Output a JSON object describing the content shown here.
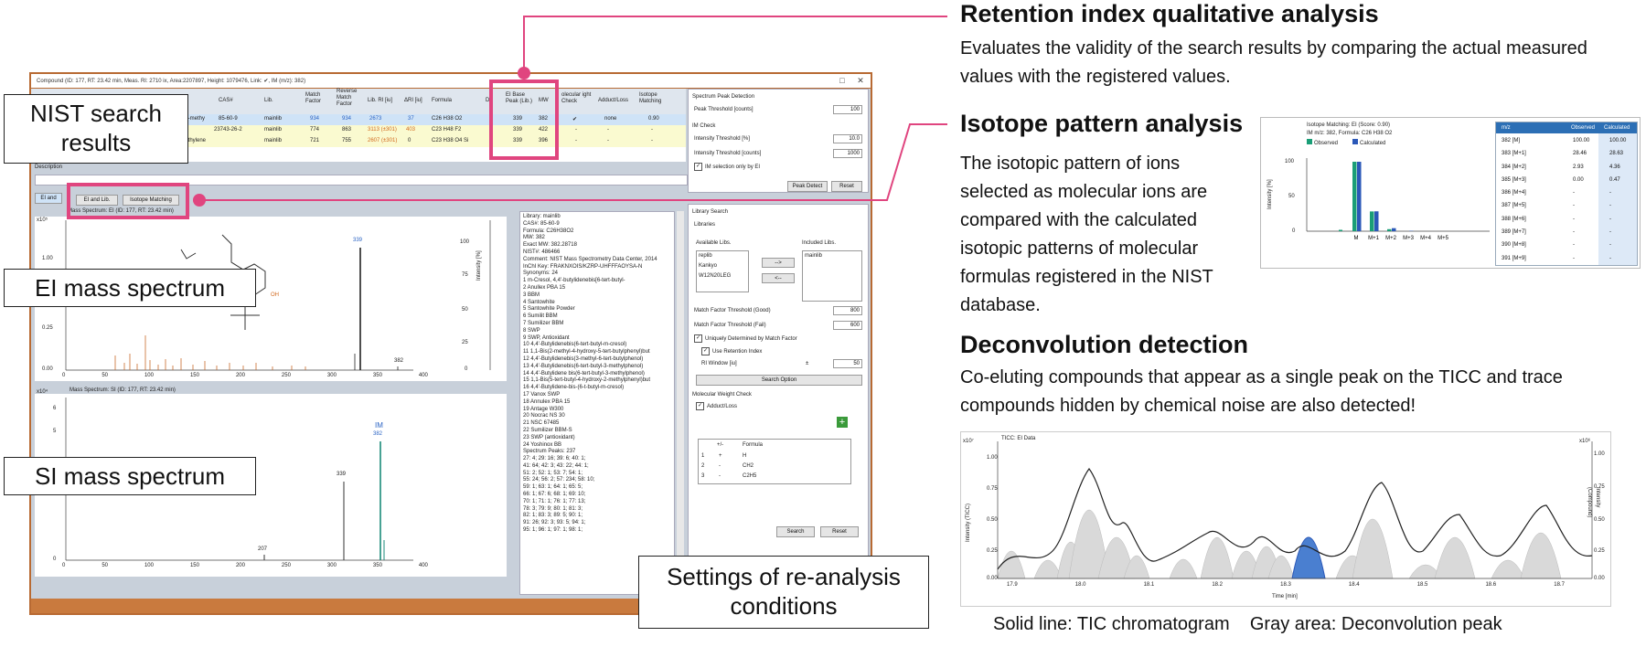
{
  "window": {
    "title": "Compound (ID: 177, RT: 23.42 min, Meas. RI: 2710 ix, Area:2207897, Height: 1079476, Link: ✔, IM (m/z): 382)",
    "controls": [
      "□",
      "✕"
    ]
  },
  "results_table": {
    "headers": [
      "CAS#",
      "Lib.",
      "Match Factor",
      "Reverse Match Factor",
      "Lib. RI [iu]",
      "ΔRI [iu]",
      "Formula",
      "D",
      "EI Base Peak (Lib.)",
      "MW",
      "olecular ight Check",
      "Adduct/Loss",
      "Isotope Matching"
    ],
    "rows": [
      {
        "name": "l-5-methy",
        "cas": "85-60-9",
        "lib": "mainlib",
        "mf": "934",
        "rmf": "934",
        "ri": "2673",
        "dri": "37",
        "formula": "C26 H38 O2",
        "base": "339",
        "mw": "382",
        "mwcheck": "✔",
        "adduct": "none",
        "iso": "0.90"
      },
      {
        "name": "",
        "cas": "23743-26-2",
        "lib": "mainlib",
        "mf": "774",
        "rmf": "863",
        "ri": "3113 (±301)",
        "dri": "403",
        "formula": "C23 H48 F2",
        "base": "339",
        "mw": "422",
        "mwcheck": "-",
        "adduct": "-",
        "iso": "-"
      },
      {
        "name": "nethylene",
        "cas": "",
        "lib": "mainlib",
        "mf": "721",
        "rmf": "755",
        "ri": "2607 (±301)",
        "dri": "0",
        "formula": "C23 H38 O4 Si",
        "base": "339",
        "mw": "396",
        "mwcheck": "-",
        "adduct": "-",
        "iso": "-"
      }
    ],
    "description_label": "Description"
  },
  "tabs": {
    "ei_and": "EI and",
    "ei_and_lib": "EI and Lib.",
    "isotope_matching": "Isotope Matching"
  },
  "ei_spectrum": {
    "title": "Mass Spectrum: EI (ID: 177, RT: 23.42 min)",
    "exp": "x10⁵",
    "yticks": [
      "1.00",
      "0.75",
      "0.50",
      "0.25",
      "0.00"
    ],
    "rticks": [
      "100",
      "75",
      "50",
      "25",
      "0"
    ],
    "xticks": [
      "0",
      "50",
      "100",
      "150",
      "200",
      "250",
      "300",
      "350",
      "400"
    ],
    "xlabel": "m/z",
    "ylabel_right": "Intensity [%]",
    "peak_labels": [
      "339",
      "382"
    ],
    "oh": "OH"
  },
  "si_spectrum": {
    "title": "Mass Spectrum: SI (ID: 177, RT: 23.42 min)",
    "exp": "x10⁴",
    "yticks": [
      "6",
      "5",
      "4",
      "3",
      "2",
      "1",
      "0"
    ],
    "xticks": [
      "0",
      "50",
      "100",
      "150",
      "200",
      "250",
      "300",
      "350",
      "400"
    ],
    "xlabel": "m/z",
    "peak_labels": [
      "339",
      "207",
      "IM",
      "382"
    ]
  },
  "library_info": {
    "lines": [
      "Library: mainlib",
      "CAS#: 85-60-9",
      "Formula: C26H38O2",
      "MW: 382",
      "Exact MW: 382.28718",
      "NIST#: 486466",
      "Comment: NIST Mass Spectrometry Data Center, 2014",
      "InChI Key: FRAKNXOIS/KZRP-UHFFFAOYSA-N",
      "Synonyms: 24",
      "1 m-Cresol, 4,4'-butylidenebis[6-tert-butyl-",
      "2 Anullex PBA 15",
      "3 BBM",
      "4 Santowhite",
      "5 Santowhite Powder",
      "6 Sumilit BBM",
      "7 Sumilizer BBM",
      "8 SWP",
      "9 SWP, Antioxidant",
      "10 4,4'-Butylidenebis(6-tert-butyl-m-cresol)",
      "11 1,1-Bis(2-methyl-4-hydroxy-5-tert-butylphenyl)but",
      "12 4,4'-Butylidenebis(3-methyl-6-tert-butylphenol)",
      "13 4,4'-Butylidenebis(6-tert-butyl-3-methylphenol)",
      "14 4,4'-Butylidene bis(6-tert-butyl-3-methylphenol)",
      "15 1,1-Bis(5-tert-butyl-4-hydroxy-2-methylphenyl)but",
      "16 4,4'-Butylidene-bis-(6-t-butyl-m-cresol)",
      "17 Vanox SWP",
      "18 Annulex PBA 15",
      "19 Antage W300",
      "20 Nocrac NS 30",
      "21 NSC 67485",
      "22 Sumilizer BBM-S",
      "23 SWP (antioxidant)",
      "24 Yoshinox BB",
      "Spectrum Peaks: 237",
      "27: 4;  29: 16;  39: 6;  40: 1;",
      "41: 64;  42: 3;  43: 22;  44: 1;",
      "51: 2;  52: 1;  53: 7;  54: 1;",
      "55: 24;  56: 2;  57: 234;  58: 10;",
      "59: 1;  63: 1;  64: 1;  65: 5;",
      "66: 1;  67: 6;  68: 1;  69: 10;",
      "70: 1;  71: 1;  76: 1;  77: 13;",
      "78: 3;  79: 9;  80: 1;  81: 3;",
      "82: 1;  83: 3;  89: 5;  90: 1;",
      "91: 26;  92: 3;  93: 5;  94: 1;",
      "95: 1;  96: 1;  97: 1;  98: 1;"
    ]
  },
  "peak_detection": {
    "title": "Spectrum Peak Detection",
    "peak_threshold_label": "Peak Threshold [counts]",
    "peak_threshold": "100",
    "im_check": "IM Check",
    "intensity_pct_label": "Intensity Threshold [%]",
    "intensity_pct": "10.0",
    "intensity_counts_label": "Intensity Threshold [counts]",
    "intensity_counts": "1000",
    "im_selection": "IM selection only by EI",
    "peak_detect_btn": "Peak Detect",
    "reset_btn": "Reset"
  },
  "library_search": {
    "title": "Library Search",
    "libraries": "Libraries",
    "available": "Available Libs.",
    "included": "Included Libs.",
    "available_items": [
      "replib",
      "Kankyo",
      "W12N20LEG"
    ],
    "included_items": [
      "mainlib"
    ],
    "arrow_right": "-->",
    "arrow_left": "<--",
    "mf_good_label": "Match Factor Threshold (Good)",
    "mf_good": "800",
    "mf_fail_label": "Match Factor Threshold (Fail)",
    "mf_fail": "600",
    "uniquely": "Uniquely Determined by Match Factor",
    "use_ri": "Use Retention Index",
    "ri_window_label": "RI Window [iu]",
    "pm": "±",
    "ri_window": "50",
    "search_option": "Search Option",
    "mw_check": "Molecular Weight Check",
    "adduct_loss": "Adduct/Loss",
    "table_headers": [
      "+/-",
      "Formula"
    ],
    "table_rows": [
      [
        "1",
        "+",
        "H"
      ],
      [
        "2",
        "-",
        "CH2"
      ],
      [
        "3",
        "-",
        "C2H5"
      ]
    ],
    "plus": "+",
    "search_btn": "Search",
    "reset_btn": "Reset"
  },
  "labels": {
    "nist": "NIST search results",
    "ei": "EI mass spectrum",
    "si": "SI mass spectrum",
    "settings": "Settings of re-analysis conditions"
  },
  "ri_section": {
    "heading": "Retention index qualitative analysis",
    "text": "Evaluates the validity of the search results by comparing the actual measured values with the registered values."
  },
  "isotope_section": {
    "heading": "Isotope pattern analysis",
    "text": "The isotopic pattern of ions selected as molecular ions are compared with the calculated isotopic patterns of molecular formulas registered in the NIST database.",
    "panel": {
      "title": "Isotope Matching: EI (Score: 0.90)",
      "subtitle": "IM m/z: 382, Formula: C26 H38 O2",
      "legend_observed": "Observed",
      "legend_calculated": "Calculated",
      "ylabel": "Intensity [%]",
      "yticks": [
        "100",
        "50",
        "0"
      ],
      "xticks": [
        "M",
        "M+1",
        "M+2",
        "M+3",
        "M+4",
        "M+5"
      ],
      "colors": {
        "observed": "#1a9e77",
        "calculated": "#2b58b8"
      }
    },
    "table": {
      "headers": [
        "m/z",
        "Observed",
        "Calculated"
      ],
      "rows": [
        [
          "382 [M]",
          "100.00",
          "100.00"
        ],
        [
          "383 [M+1]",
          "28.46",
          "28.63"
        ],
        [
          "384 [M+2]",
          "2.93",
          "4.36"
        ],
        [
          "385 [M+3]",
          "0.00",
          "0.47"
        ],
        [
          "386 [M+4]",
          "-",
          "-"
        ],
        [
          "387 [M+5]",
          "-",
          "-"
        ],
        [
          "388 [M+6]",
          "-",
          "-"
        ],
        [
          "389 [M+7]",
          "-",
          "-"
        ],
        [
          "390 [M+8]",
          "-",
          "-"
        ],
        [
          "391 [M+9]",
          "-",
          "-"
        ]
      ]
    }
  },
  "deconv_section": {
    "heading": "Deconvolution detection",
    "text": "Co-eluting compounds that appear as a single peak on the TICC and trace compounds hidden by chemical noise are also detected!",
    "chart": {
      "title": "TICC: EI Data",
      "exp_left": "x10⁷",
      "exp_right": "x10⁶",
      "ylabel_left": "Intensity (TICC)",
      "ylabel_right": "Intensity (Compound)",
      "yticks_left": [
        "1.00",
        "0.75",
        "0.50",
        "0.25",
        "0.00"
      ],
      "yticks_right": [
        "1.00",
        "0.75",
        "0.50",
        "0.25",
        "0.00"
      ],
      "xticks": [
        "17.9",
        "18.0",
        "18.1",
        "18.2",
        "18.3",
        "18.4",
        "18.5",
        "18.6",
        "18.7"
      ],
      "xlabel": "Time [min]"
    },
    "caption": "Solid line: TIC chromatogram    Gray area: Deconvolution peak"
  },
  "chart_data": [
    {
      "type": "bar",
      "title": "Isotope Matching: EI (Score: 0.90)",
      "categories": [
        "M",
        "M+1",
        "M+2",
        "M+3",
        "M+4",
        "M+5"
      ],
      "ylabel": "Intensity [%]",
      "ylim": [
        0,
        100
      ],
      "series": [
        {
          "name": "Observed",
          "values": [
            100.0,
            28.46,
            2.93,
            0.0,
            0,
            0
          ]
        },
        {
          "name": "Calculated",
          "values": [
            100.0,
            28.63,
            4.36,
            0.47,
            0,
            0
          ]
        }
      ]
    }
  ]
}
